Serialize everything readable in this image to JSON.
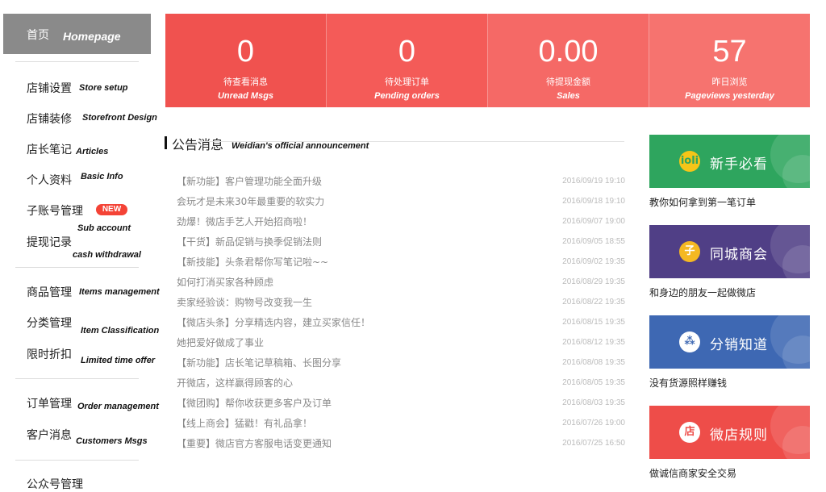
{
  "sidebar": {
    "home": {
      "zh": "首页",
      "en": "Homepage"
    },
    "items": [
      {
        "zh": "店铺设置",
        "en": "Store setup"
      },
      {
        "zh": "店铺装修",
        "en": "Storefront Design"
      },
      {
        "zh": "店长笔记",
        "en": "Articles"
      },
      {
        "zh": "个人资料",
        "en": "Basic Info"
      },
      {
        "zh": "子账号管理",
        "en": "Sub account"
      },
      {
        "zh": "提现记录",
        "en": "cash withdrawal"
      },
      {
        "zh": "商品管理",
        "en": "Items management"
      },
      {
        "zh": "分类管理",
        "en": "Item Classification"
      },
      {
        "zh": "限时折扣",
        "en": "Limited time offer"
      },
      {
        "zh": "订单管理",
        "en": "Order management"
      },
      {
        "zh": "客户消息",
        "en": "Customers Msgs"
      },
      {
        "zh": "公众号管理",
        "en": ""
      }
    ],
    "new_badge": "NEW"
  },
  "stats": [
    {
      "value": "0",
      "zh": "待查看消息",
      "en": "Unread Msgs",
      "color": "#f0524f"
    },
    {
      "value": "0",
      "zh": "待处理订单",
      "en": "Pending orders",
      "color": "#f45b58"
    },
    {
      "value": "0.00",
      "zh": "待提现金额",
      "en": "Sales",
      "color": "#f56966"
    },
    {
      "value": "57",
      "zh": "昨日浏览",
      "en": "Pageviews yesterday",
      "color": "#f6736f"
    }
  ],
  "announcements": {
    "title": "公告消息",
    "title_en": "Weidian's official announcement",
    "items": [
      {
        "title": "【新功能】客户管理功能全面升级",
        "date": "2016/09/19 19:10"
      },
      {
        "title": "会玩才是未来30年最重要的软实力",
        "date": "2016/09/18 19:10"
      },
      {
        "title": "劲爆！微店手艺人开始招商啦！",
        "date": "2016/09/07 19:00"
      },
      {
        "title": "【干货】新品促销与换季促销法则",
        "date": "2016/09/05 18:55"
      },
      {
        "title": "【新技能】头条君帮你写笔记啦~~",
        "date": "2016/09/02 19:35"
      },
      {
        "title": "如何打消买家各种顾虑",
        "date": "2016/08/29 19:35"
      },
      {
        "title": "卖家经验谈：购物号改变我一生",
        "date": "2016/08/22 19:35"
      },
      {
        "title": "【微店头条】分享精选内容，建立买家信任！",
        "date": "2016/08/15 19:35"
      },
      {
        "title": "她把爱好做成了事业",
        "date": "2016/08/12 19:35"
      },
      {
        "title": "【新功能】店长笔记草稿箱、长图分享",
        "date": "2016/08/08 19:35"
      },
      {
        "title": "开微店，这样赢得顾客的心",
        "date": "2016/08/05 19:35"
      },
      {
        "title": "【微团购】帮你收获更多客户及订单",
        "date": "2016/08/03 19:35"
      },
      {
        "title": "【线上商会】猛戳！有礼品拿！",
        "date": "2016/07/26 19:00"
      },
      {
        "title": "【重要】微店官方客服电话变更通知",
        "date": "2016/07/25 16:50"
      }
    ]
  },
  "cards": [
    {
      "label": "新手必看",
      "icon_text": "ioli",
      "icon": "lightbulb-icon",
      "caption": "教你如何拿到第一笔订单",
      "bg": "#2ea55e",
      "icon_bg": "#f5c518",
      "icon_color": "#2ea55e"
    },
    {
      "label": "同城商会",
      "icon_text": "子",
      "icon": "coin-icon",
      "caption": "和身边的朋友一起做微店",
      "bg": "#503f86",
      "icon_bg": "#f5b822",
      "icon_color": "#fff"
    },
    {
      "label": "分销知道",
      "icon_text": "⁂",
      "icon": "network-icon",
      "caption": "没有货源照样赚钱",
      "bg": "#3e68b3",
      "icon_bg": "#ffffff",
      "icon_color": "#3e68b3"
    },
    {
      "label": "微店规则",
      "icon_text": "店",
      "icon": "shop-icon",
      "caption": "做诚信商家安全交易",
      "bg": "#ee4d49",
      "icon_bg": "#ffffff",
      "icon_color": "#ee4d49"
    }
  ]
}
